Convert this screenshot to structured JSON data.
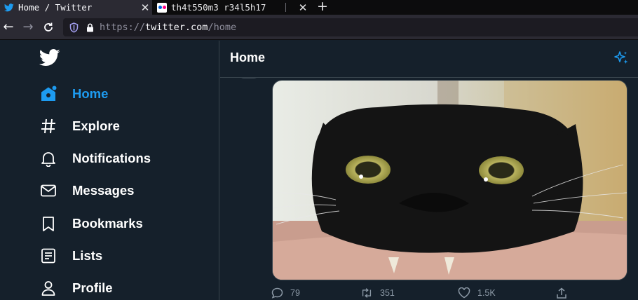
{
  "browser": {
    "tabs": [
      {
        "title": "Home / Twitter",
        "favicon": "twitter-bird-icon",
        "active": true
      },
      {
        "title": "th4t550m3 r34l5h17",
        "favicon": "flickr-icon",
        "active": false
      }
    ],
    "url": {
      "scheme": "https://",
      "host": "twitter.com",
      "path": "/home"
    }
  },
  "sidebar": {
    "items": [
      {
        "label": "Home",
        "icon": "home-icon",
        "active": true
      },
      {
        "label": "Explore",
        "icon": "hashtag-icon"
      },
      {
        "label": "Notifications",
        "icon": "bell-icon"
      },
      {
        "label": "Messages",
        "icon": "envelope-icon"
      },
      {
        "label": "Bookmarks",
        "icon": "bookmark-icon"
      },
      {
        "label": "Lists",
        "icon": "list-icon"
      },
      {
        "label": "Profile",
        "icon": "person-icon"
      }
    ]
  },
  "main": {
    "title": "Home",
    "tweet": {
      "actions": {
        "replies": "79",
        "retweets": "351",
        "likes": "1.5K"
      }
    }
  },
  "colors": {
    "background": "#15202b",
    "accent": "#1d9bf0",
    "border": "#38444d",
    "muted": "#8b98a5"
  }
}
